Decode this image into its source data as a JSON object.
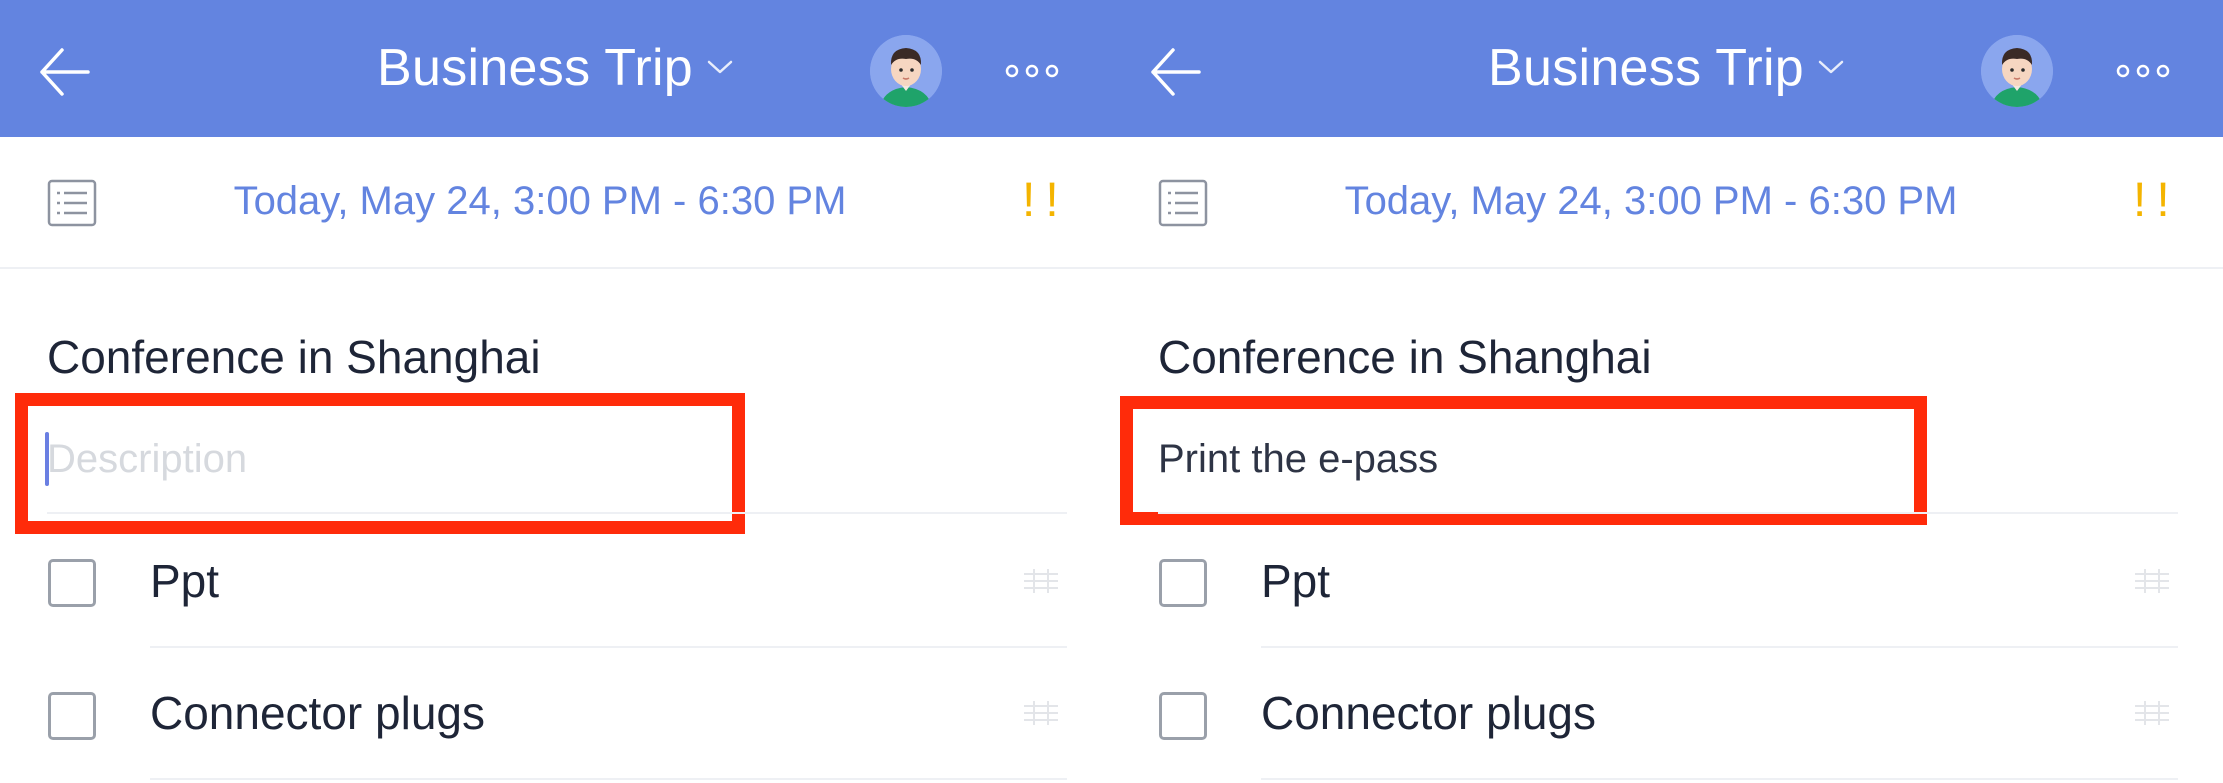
{
  "screens": [
    {
      "header": {
        "title": "Business Trip"
      },
      "schedule": {
        "date_time": "Today, May 24, 3:00 PM - 6:30 PM",
        "priority": "!!"
      },
      "task": {
        "title": "Conference in Shanghai",
        "description_value": "",
        "description_placeholder": "Description"
      },
      "checklist": [
        {
          "label": "Ppt",
          "checked": false
        },
        {
          "label": "Connector plugs",
          "checked": false
        }
      ]
    },
    {
      "header": {
        "title": "Business Trip"
      },
      "schedule": {
        "date_time": "Today, May 24, 3:00 PM - 6:30 PM",
        "priority": "!!"
      },
      "task": {
        "title": "Conference in Shanghai",
        "description_value": "Print the e-pass",
        "description_placeholder": "Description"
      },
      "checklist": [
        {
          "label": "Ppt",
          "checked": false
        },
        {
          "label": "Connector plugs",
          "checked": false
        }
      ]
    }
  ],
  "colors": {
    "header_bg": "#6384e0",
    "accent": "#6384e0",
    "priority": "#f4b400",
    "highlight": "#ff2b0a",
    "text_dark": "#1e2537"
  },
  "icons": [
    "back-arrow-icon",
    "chevron-down-icon",
    "avatar",
    "more-icon",
    "note-icon",
    "drag-handle-icon"
  ]
}
